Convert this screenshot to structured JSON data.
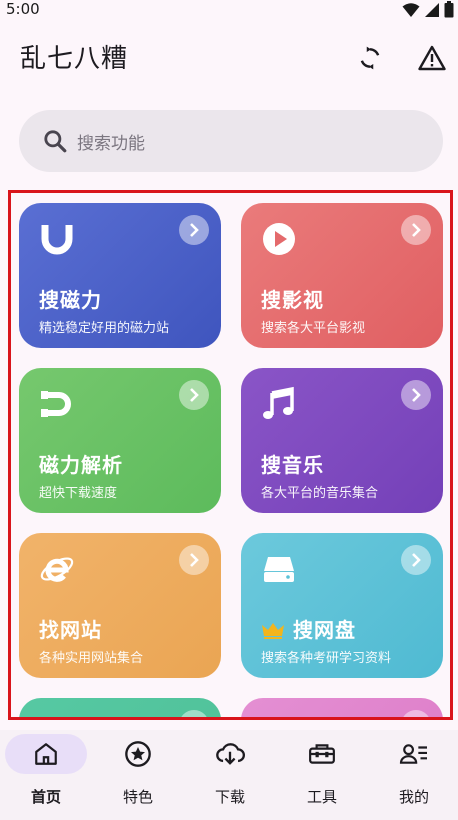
{
  "status": {
    "time": "5:00"
  },
  "header": {
    "title": "乱七八糟"
  },
  "search": {
    "placeholder": "搜索功能"
  },
  "cards": [
    {
      "title": "搜磁力",
      "subtitle": "精选稳定好用的磁力站",
      "icon": "magnet-u-icon",
      "color_from": "#5a6fd3",
      "color_to": "#3f55be"
    },
    {
      "title": "搜影视",
      "subtitle": "搜索各大平台影视",
      "icon": "play-circle-icon",
      "color_from": "#ea7b7b",
      "color_to": "#e05f62"
    },
    {
      "title": "磁力解析",
      "subtitle": "超快下载速度",
      "icon": "magnet-icon",
      "color_from": "#76c86e",
      "color_to": "#5dbb5c"
    },
    {
      "title": "搜音乐",
      "subtitle": "各大平台的音乐集合",
      "icon": "music-note-icon",
      "color_from": "#8a55c7",
      "color_to": "#7440b8"
    },
    {
      "title": "找网站",
      "subtitle": "各种实用网站集合",
      "icon": "internet-explorer-icon",
      "color_from": "#f1b36a",
      "color_to": "#eaa553"
    },
    {
      "title": "搜网盘",
      "subtitle": "搜索各种考研学习资料",
      "icon": "drive-icon",
      "color_from": "#6cc9dc",
      "color_to": "#4fbad2"
    },
    {
      "title": "",
      "subtitle": "",
      "icon": "",
      "color_from": "#56c9a3",
      "color_to": "#4fbf96"
    },
    {
      "title": "",
      "subtitle": "",
      "icon": "",
      "color_from": "#e48fd3",
      "color_to": "#dc79c6"
    }
  ],
  "nav": [
    {
      "label": "首页",
      "icon": "home-icon",
      "active": true
    },
    {
      "label": "特色",
      "icon": "star-circle-icon",
      "active": false
    },
    {
      "label": "下载",
      "icon": "cloud-download-icon",
      "active": false
    },
    {
      "label": "工具",
      "icon": "toolbox-icon",
      "active": false
    },
    {
      "label": "我的",
      "icon": "person-list-icon",
      "active": false
    }
  ],
  "colors": {
    "highlight_frame": "#d9141b",
    "nav_active": "#e8def8",
    "crown": "#f2b51d"
  }
}
